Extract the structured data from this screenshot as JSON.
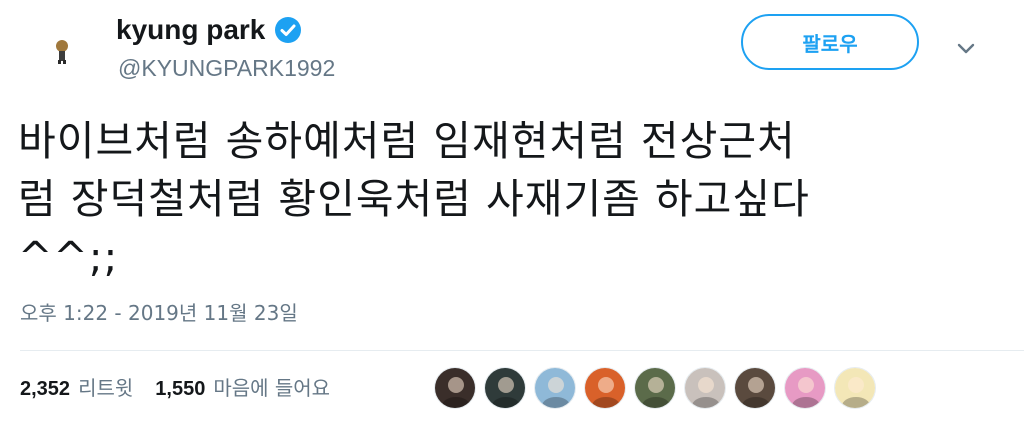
{
  "tweet": {
    "author": {
      "name": "kyung park",
      "handle": "@KYUNGPARK1992",
      "verified": true,
      "avatar_icon": "avatar-icon"
    },
    "follow_label": "팔로우",
    "menu_icon": "chevron-down-icon",
    "text_lines": [
      "바이브처럼 송하예처럼 임재현처럼 전상근처",
      "럼 장덕철처럼 황인욱처럼 사재기좀 하고싶다",
      "^^;;"
    ],
    "timestamp": "오후 1:22 - 2019년 11월 23일",
    "retweets": {
      "count": "2,352",
      "label": "리트윗"
    },
    "likes": {
      "count": "1,550",
      "label": "마음에 들어요"
    },
    "likers": [
      {
        "icon": "liker-avatar-icon",
        "color": "#3a2e2a"
      },
      {
        "icon": "liker-avatar-icon",
        "color": "#2f3b3a"
      },
      {
        "icon": "liker-avatar-icon",
        "color": "#8fb9d8"
      },
      {
        "icon": "liker-avatar-icon",
        "color": "#d9612a"
      },
      {
        "icon": "liker-avatar-icon",
        "color": "#5b6b4a"
      },
      {
        "icon": "liker-avatar-icon",
        "color": "#c9c1bc"
      },
      {
        "icon": "liker-avatar-icon",
        "color": "#5a4a3e"
      },
      {
        "icon": "liker-avatar-icon",
        "color": "#e79ac4"
      },
      {
        "icon": "liker-avatar-icon",
        "color": "#f3e7b7"
      }
    ],
    "colors": {
      "accent": "#1da1f2",
      "text": "#14171a",
      "muted": "#657786"
    }
  }
}
